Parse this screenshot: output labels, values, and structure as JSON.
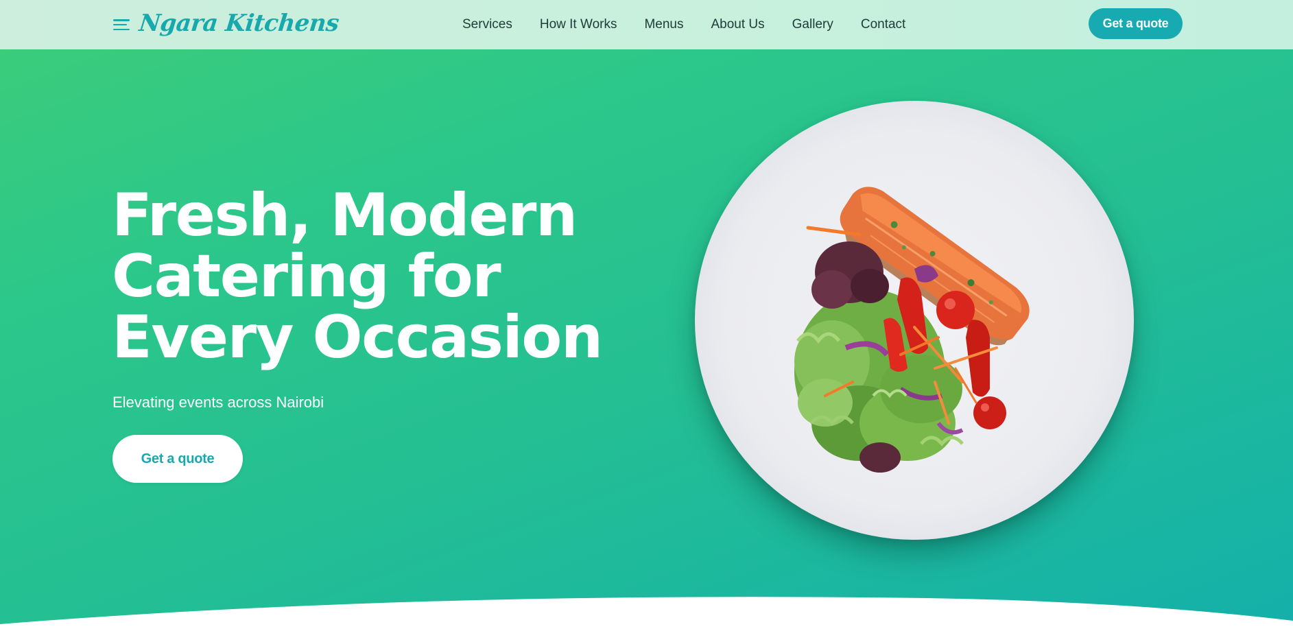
{
  "brand": {
    "name": "Ngara Kitchens",
    "accent": "#17aab0"
  },
  "nav": {
    "items": [
      {
        "label": "Services"
      },
      {
        "label": "How It Works"
      },
      {
        "label": "Menus"
      },
      {
        "label": "About Us"
      },
      {
        "label": "Gallery"
      },
      {
        "label": "Contact"
      }
    ],
    "cta_label": "Get a quote"
  },
  "hero": {
    "title": "Fresh, Modern Catering for Every Occasion",
    "subtitle": "Elevating events across Nairobi",
    "cta_label": "Get a quote",
    "image": "salmon-salad-plate"
  },
  "icons": {
    "menu": "hamburger-menu-icon"
  }
}
